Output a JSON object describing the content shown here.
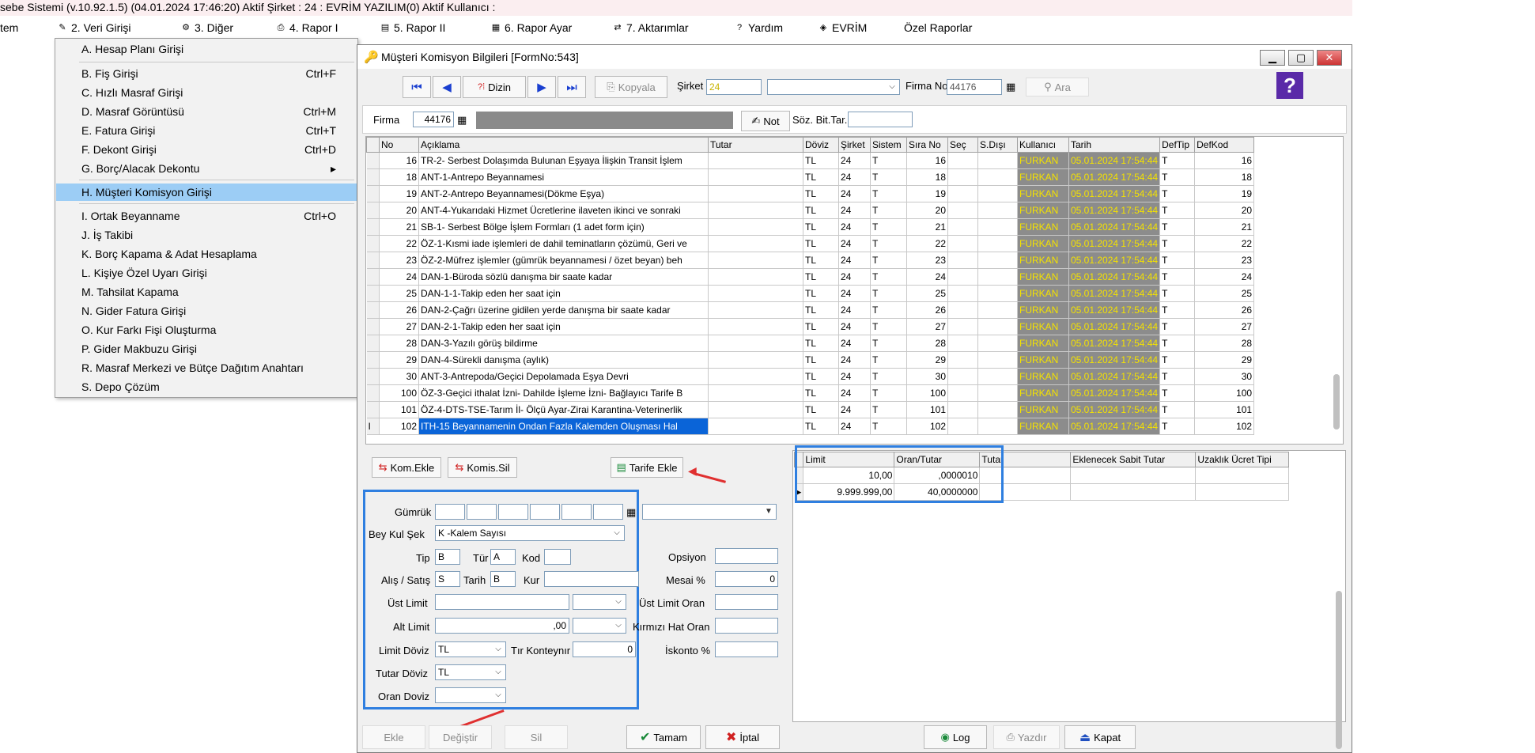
{
  "app": {
    "title": "sebe Sistemi (v.10.92.1.5) (04.01.2024 17:46:20) Aktif Şirket : 24 : EVRİM YAZILIM(0) Aktif Kullanıcı :"
  },
  "menubar": [
    {
      "label": "tem"
    },
    {
      "label": "2.  Veri Girişi"
    },
    {
      "label": "3.  Diğer"
    },
    {
      "label": "4.  Rapor I"
    },
    {
      "label": "5.  Rapor II"
    },
    {
      "label": "6.  Rapor Ayar"
    },
    {
      "label": "7.  Aktarımlar"
    },
    {
      "label": "Yardım"
    },
    {
      "label": "EVRİM"
    },
    {
      "label": "Özel Raporlar"
    }
  ],
  "dropdown": [
    {
      "label": "A.  Hesap Planı Girişi",
      "shortcut": ""
    },
    {
      "label": "B.  Fiş Girişi",
      "shortcut": "Ctrl+F"
    },
    {
      "label": "C.  Hızlı Masraf Girişi",
      "shortcut": ""
    },
    {
      "label": "D.  Masraf Görüntüsü",
      "shortcut": "Ctrl+M"
    },
    {
      "label": "E.  Fatura Girişi",
      "shortcut": "Ctrl+T"
    },
    {
      "label": "F.  Dekont Girişi",
      "shortcut": "Ctrl+D"
    },
    {
      "label": "G.  Borç/Alacak Dekontu",
      "shortcut": ""
    },
    {
      "label": "H.  Müşteri Komisyon Girişi",
      "shortcut": ""
    },
    {
      "label": "I.  Ortak Beyanname",
      "shortcut": "Ctrl+O"
    },
    {
      "label": "J.  İş Takibi",
      "shortcut": ""
    },
    {
      "label": "K.  Borç Kapama & Adat Hesaplama",
      "shortcut": ""
    },
    {
      "label": "L.  Kişiye Özel Uyarı Girişi",
      "shortcut": ""
    },
    {
      "label": "M.  Tahsilat Kapama",
      "shortcut": ""
    },
    {
      "label": "N. Gider Fatura Girişi",
      "shortcut": ""
    },
    {
      "label": "O. Kur Farkı Fişi Oluşturma",
      "shortcut": ""
    },
    {
      "label": "P. Gider Makbuzu Girişi",
      "shortcut": ""
    },
    {
      "label": "R. Masraf Merkezi ve Bütçe Dağıtım Anahtarı",
      "shortcut": ""
    },
    {
      "label": "S. Depo Çözüm",
      "shortcut": ""
    }
  ],
  "form": {
    "title": "Müşteri Komisyon Bilgileri [FormNo:543]",
    "toolbar": {
      "dizin": "Dizin",
      "kopyala": "Kopyala",
      "sirket_label": "Şirket",
      "sirket_value": "24",
      "firma_no_label": "Firma No",
      "firma_no_value": "44176",
      "ara": "Ara"
    },
    "firma_row": {
      "firma_label": "Firma",
      "firma_value": "44176",
      "not_label": "Not",
      "soz_label": "Söz. Bit.Tar."
    },
    "grid": {
      "columns": [
        "No",
        "Açıklama",
        "Tutar",
        "Döviz",
        "Şirket",
        "Sistem",
        "Sıra No",
        "Seç",
        "S.Dışı",
        "Kullanıcı",
        "Tarih",
        "DefTip",
        "DefKod"
      ],
      "rows": [
        {
          "no": "16",
          "aciklama": "TR-2- Serbest Dolaşımda Bulunan Eşyaya İlişkin Transit İşlem",
          "doviz": "TL",
          "sirket": "24",
          "sistem": "T",
          "sira": "16",
          "kullanici": "FURKAN",
          "tarih": "05.01.2024 17:54:44",
          "deftip": "T",
          "defkod": "16"
        },
        {
          "no": "18",
          "aciklama": "ANT-1-Antrepo Beyannamesi",
          "doviz": "TL",
          "sirket": "24",
          "sistem": "T",
          "sira": "18",
          "kullanici": "FURKAN",
          "tarih": "05.01.2024 17:54:44",
          "deftip": "T",
          "defkod": "18"
        },
        {
          "no": "19",
          "aciklama": "ANT-2-Antrepo Beyannamesi(Dökme Eşya)",
          "doviz": "TL",
          "sirket": "24",
          "sistem": "T",
          "sira": "19",
          "kullanici": "FURKAN",
          "tarih": "05.01.2024 17:54:44",
          "deftip": "T",
          "defkod": "19"
        },
        {
          "no": "20",
          "aciklama": "ANT-4-Yukarıdaki Hizmet Ücretlerine ilaveten ikinci ve sonraki",
          "doviz": "TL",
          "sirket": "24",
          "sistem": "T",
          "sira": "20",
          "kullanici": "FURKAN",
          "tarih": "05.01.2024 17:54:44",
          "deftip": "T",
          "defkod": "20"
        },
        {
          "no": "21",
          "aciklama": "SB-1- Serbest Bölge İşlem Formları (1 adet form için)",
          "doviz": "TL",
          "sirket": "24",
          "sistem": "T",
          "sira": "21",
          "kullanici": "FURKAN",
          "tarih": "05.01.2024 17:54:44",
          "deftip": "T",
          "defkod": "21"
        },
        {
          "no": "22",
          "aciklama": "ÖZ-1-Kısmi iade işlemleri de dahil teminatların çözümü, Geri ve",
          "doviz": "TL",
          "sirket": "24",
          "sistem": "T",
          "sira": "22",
          "kullanici": "FURKAN",
          "tarih": "05.01.2024 17:54:44",
          "deftip": "T",
          "defkod": "22"
        },
        {
          "no": "23",
          "aciklama": "ÖZ-2-Müfrez işlemler (gümrük beyannamesi / özet beyan) beh",
          "doviz": "TL",
          "sirket": "24",
          "sistem": "T",
          "sira": "23",
          "kullanici": "FURKAN",
          "tarih": "05.01.2024 17:54:44",
          "deftip": "T",
          "defkod": "23"
        },
        {
          "no": "24",
          "aciklama": "DAN-1-Büroda sözlü danışma bir saate kadar",
          "doviz": "TL",
          "sirket": "24",
          "sistem": "T",
          "sira": "24",
          "kullanici": "FURKAN",
          "tarih": "05.01.2024 17:54:44",
          "deftip": "T",
          "defkod": "24"
        },
        {
          "no": "25",
          "aciklama": "DAN-1-1-Takip eden her saat için",
          "doviz": "TL",
          "sirket": "24",
          "sistem": "T",
          "sira": "25",
          "kullanici": "FURKAN",
          "tarih": "05.01.2024 17:54:44",
          "deftip": "T",
          "defkod": "25"
        },
        {
          "no": "26",
          "aciklama": "DAN-2-Çağrı üzerine gidilen yerde danışma bir saate kadar",
          "doviz": "TL",
          "sirket": "24",
          "sistem": "T",
          "sira": "26",
          "kullanici": "FURKAN",
          "tarih": "05.01.2024 17:54:44",
          "deftip": "T",
          "defkod": "26"
        },
        {
          "no": "27",
          "aciklama": "DAN-2-1-Takip eden her saat için",
          "doviz": "TL",
          "sirket": "24",
          "sistem": "T",
          "sira": "27",
          "kullanici": "FURKAN",
          "tarih": "05.01.2024 17:54:44",
          "deftip": "T",
          "defkod": "27"
        },
        {
          "no": "28",
          "aciklama": "DAN-3-Yazılı görüş bildirme",
          "doviz": "TL",
          "sirket": "24",
          "sistem": "T",
          "sira": "28",
          "kullanici": "FURKAN",
          "tarih": "05.01.2024 17:54:44",
          "deftip": "T",
          "defkod": "28"
        },
        {
          "no": "29",
          "aciklama": "DAN-4-Sürekli danışma (aylık)",
          "doviz": "TL",
          "sirket": "24",
          "sistem": "T",
          "sira": "29",
          "kullanici": "FURKAN",
          "tarih": "05.01.2024 17:54:44",
          "deftip": "T",
          "defkod": "29"
        },
        {
          "no": "30",
          "aciklama": "ANT-3-Antrepoda/Geçici Depolamada Eşya Devri",
          "doviz": "TL",
          "sirket": "24",
          "sistem": "T",
          "sira": "30",
          "kullanici": "FURKAN",
          "tarih": "05.01.2024 17:54:44",
          "deftip": "T",
          "defkod": "30"
        },
        {
          "no": "100",
          "aciklama": "ÖZ-3-Geçici ithalat İzni- Dahilde İşleme İzni- Bağlayıcı Tarife B",
          "doviz": "TL",
          "sirket": "24",
          "sistem": "T",
          "sira": "100",
          "kullanici": "FURKAN",
          "tarih": "05.01.2024 17:54:44",
          "deftip": "T",
          "defkod": "100"
        },
        {
          "no": "101",
          "aciklama": "ÖZ-4-DTS-TSE-Tarım İl- Ölçü Ayar-Zirai Karantina-Veterinerlik",
          "doviz": "TL",
          "sirket": "24",
          "sistem": "T",
          "sira": "101",
          "kullanici": "FURKAN",
          "tarih": "05.01.2024 17:54:44",
          "deftip": "T",
          "defkod": "101"
        },
        {
          "no": "102",
          "aciklama": "ITH-15 Beyannamenin Ondan Fazla Kalemden Oluşması Hal",
          "doviz": "TL",
          "sirket": "24",
          "sistem": "T",
          "sira": "102",
          "kullanici": "FURKAN",
          "tarih": "05.01.2024 17:54:44",
          "deftip": "T",
          "defkod": "102"
        }
      ]
    },
    "actions": {
      "kom_ekle": "Kom.Ekle",
      "komis_sil": "Komis.Sil",
      "tarife_ekle": "Tarife Ekle"
    },
    "detail": {
      "gumruk_label": "Gümrük",
      "bey_kul_sek_label": "Bey Kul Şek",
      "bey_kul_sek_value": "K -Kalem Sayısı",
      "tip_label": "Tip",
      "tip_value": "B",
      "tur_label": "Tür",
      "tur_value": "A",
      "kod_label": "Kod",
      "alis_satis_label": "Alış / Satış",
      "alis_satis_value": "S",
      "tarih_label": "Tarih",
      "tarih_value": "B",
      "kur_label": "Kur",
      "ust_limit_label": "Üst Limit",
      "alt_limit_label": "Alt Limit",
      "alt_limit_value": ",00",
      "limit_doviz_label": "Limit Döviz",
      "limit_doviz_value": "TL",
      "tir_konteynir_label": "Tır Konteynır",
      "tir_konteynir_value": "0",
      "tutar_doviz_label": "Tutar Döviz",
      "tutar_doviz_value": "TL",
      "oran_doviz_label": "Oran Doviz",
      "opsiyon_label": "Opsiyon",
      "mesai_label": "Mesai %",
      "mesai_value": "0",
      "ust_limit_oran_label": "Üst Limit Oran",
      "kirmizi_hat_label": "Kırmızı Hat Oran",
      "iskonto_label": "İskonto %"
    },
    "tarife_grid": {
      "columns": [
        "Limit",
        "Oran/Tutar",
        "Tutar",
        "Eklenecek Sabit Tutar",
        "Uzaklık Ücret Tipi"
      ],
      "rows": [
        {
          "limit": "10,00",
          "oran": ",0000010"
        },
        {
          "limit": "9.999.999,00",
          "oran": "40,0000000"
        }
      ]
    },
    "bottom": {
      "ekle": "Ekle",
      "degistir": "Değiştir",
      "sil": "Sil",
      "tamam": "Tamam",
      "iptal": "İptal",
      "log": "Log",
      "yazdir": "Yazdır",
      "kapat": "Kapat"
    }
  },
  "colors": {
    "highlight_box": "#2f7fe0",
    "arrow": "#e03030",
    "selected_menu": "#9ccdf5"
  }
}
